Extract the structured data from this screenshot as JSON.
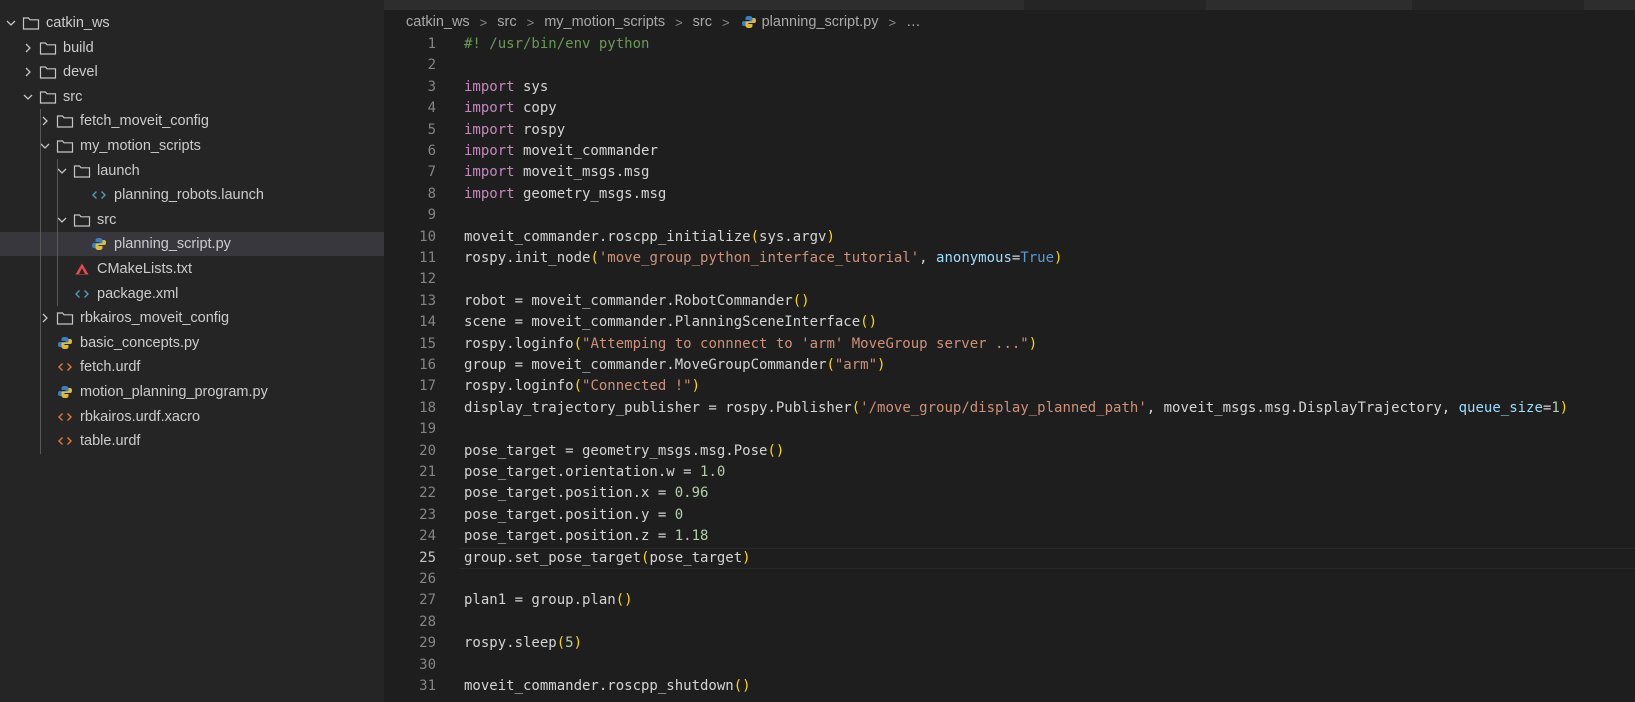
{
  "explorer": {
    "items": [
      {
        "label": "catkin_ws",
        "depth": 0,
        "type": "folder",
        "expanded": true
      },
      {
        "label": "build",
        "depth": 1,
        "type": "folder",
        "expanded": false
      },
      {
        "label": "devel",
        "depth": 1,
        "type": "folder",
        "expanded": false
      },
      {
        "label": "src",
        "depth": 1,
        "type": "folder",
        "expanded": true
      },
      {
        "label": "fetch_moveit_config",
        "depth": 2,
        "type": "folder",
        "expanded": false
      },
      {
        "label": "my_motion_scripts",
        "depth": 2,
        "type": "folder",
        "expanded": true
      },
      {
        "label": "launch",
        "depth": 3,
        "type": "folder",
        "expanded": true
      },
      {
        "label": "planning_robots.launch",
        "depth": 4,
        "type": "xml"
      },
      {
        "label": "src",
        "depth": 3,
        "type": "folder",
        "expanded": true
      },
      {
        "label": "planning_script.py",
        "depth": 4,
        "type": "python",
        "selected": true
      },
      {
        "label": "CMakeLists.txt",
        "depth": 3,
        "type": "cmake"
      },
      {
        "label": "package.xml",
        "depth": 3,
        "type": "xml"
      },
      {
        "label": "rbkairos_moveit_config",
        "depth": 2,
        "type": "folder",
        "expanded": false
      },
      {
        "label": "basic_concepts.py",
        "depth": 2,
        "type": "python"
      },
      {
        "label": "fetch.urdf",
        "depth": 2,
        "type": "urdf"
      },
      {
        "label": "motion_planning_program.py",
        "depth": 2,
        "type": "python"
      },
      {
        "label": "rbkairos.urdf.xacro",
        "depth": 2,
        "type": "urdf"
      },
      {
        "label": "table.urdf",
        "depth": 2,
        "type": "urdf"
      }
    ]
  },
  "breadcrumb": {
    "items": [
      "catkin_ws",
      "src",
      "my_motion_scripts",
      "src",
      "planning_script.py"
    ],
    "ellipsis": "…"
  },
  "editor": {
    "active_line": 25,
    "lines": [
      [
        [
          "cmt",
          "#! /usr/bin/env python"
        ]
      ],
      [],
      [
        [
          "kw",
          "import"
        ],
        [
          "mod",
          " sys"
        ]
      ],
      [
        [
          "kw",
          "import"
        ],
        [
          "mod",
          " copy"
        ]
      ],
      [
        [
          "kw",
          "import"
        ],
        [
          "mod",
          " rospy"
        ]
      ],
      [
        [
          "kw",
          "import"
        ],
        [
          "mod",
          " moveit_commander"
        ]
      ],
      [
        [
          "kw",
          "import"
        ],
        [
          "mod",
          " moveit_msgs.msg"
        ]
      ],
      [
        [
          "kw",
          "import"
        ],
        [
          "mod",
          " geometry_msgs.msg"
        ]
      ],
      [],
      [
        [
          "",
          "moveit_commander.roscpp_initialize"
        ],
        [
          "br",
          "("
        ],
        [
          "",
          "sys.argv"
        ],
        [
          "br",
          ")"
        ]
      ],
      [
        [
          "",
          "rospy.init_node"
        ],
        [
          "br",
          "("
        ],
        [
          "str",
          "'move_group_python_interface_tutorial'"
        ],
        [
          "",
          ", "
        ],
        [
          "par",
          "anonymous"
        ],
        [
          "",
          "="
        ],
        [
          "bool",
          "True"
        ],
        [
          "br",
          ")"
        ]
      ],
      [],
      [
        [
          "",
          "robot = moveit_commander.RobotCommander"
        ],
        [
          "br",
          "()"
        ]
      ],
      [
        [
          "",
          "scene = moveit_commander.PlanningSceneInterface"
        ],
        [
          "br",
          "()"
        ]
      ],
      [
        [
          "",
          "rospy.loginfo"
        ],
        [
          "br",
          "("
        ],
        [
          "str",
          "\"Attemping to connnect to 'arm' MoveGroup server ...\""
        ],
        [
          "br",
          ")"
        ]
      ],
      [
        [
          "",
          "group = moveit_commander.MoveGroupCommander"
        ],
        [
          "br",
          "("
        ],
        [
          "str",
          "\"arm\""
        ],
        [
          "br",
          ")"
        ]
      ],
      [
        [
          "",
          "rospy.loginfo"
        ],
        [
          "br",
          "("
        ],
        [
          "str",
          "\"Connected !\""
        ],
        [
          "br",
          ")"
        ]
      ],
      [
        [
          "",
          "display_trajectory_publisher = rospy.Publisher"
        ],
        [
          "br",
          "("
        ],
        [
          "str",
          "'/move_group/display_planned_path'"
        ],
        [
          "",
          ", moveit_msgs.msg.DisplayTrajectory, "
        ],
        [
          "par",
          "queue_size"
        ],
        [
          "",
          "="
        ],
        [
          "num",
          "1"
        ],
        [
          "br",
          ")"
        ]
      ],
      [],
      [
        [
          "",
          "pose_target = geometry_msgs.msg.Pose"
        ],
        [
          "br",
          "()"
        ]
      ],
      [
        [
          "",
          "pose_target.orientation.w = "
        ],
        [
          "num",
          "1.0"
        ]
      ],
      [
        [
          "",
          "pose_target.position.x = "
        ],
        [
          "num",
          "0.96"
        ]
      ],
      [
        [
          "",
          "pose_target.position.y = "
        ],
        [
          "num",
          "0"
        ]
      ],
      [
        [
          "",
          "pose_target.position.z = "
        ],
        [
          "num",
          "1.18"
        ]
      ],
      [
        [
          "",
          "group.set_pose_target"
        ],
        [
          "br",
          "("
        ],
        [
          "",
          "pose_target"
        ],
        [
          "br",
          ")"
        ]
      ],
      [],
      [
        [
          "",
          "plan1 = group.plan"
        ],
        [
          "br",
          "()"
        ]
      ],
      [],
      [
        [
          "",
          "rospy.sleep"
        ],
        [
          "br",
          "("
        ],
        [
          "num",
          "5"
        ],
        [
          "br",
          ")"
        ]
      ],
      [],
      [
        [
          "",
          "moveit_commander.roscpp_shutdown"
        ],
        [
          "br",
          "()"
        ]
      ]
    ]
  }
}
